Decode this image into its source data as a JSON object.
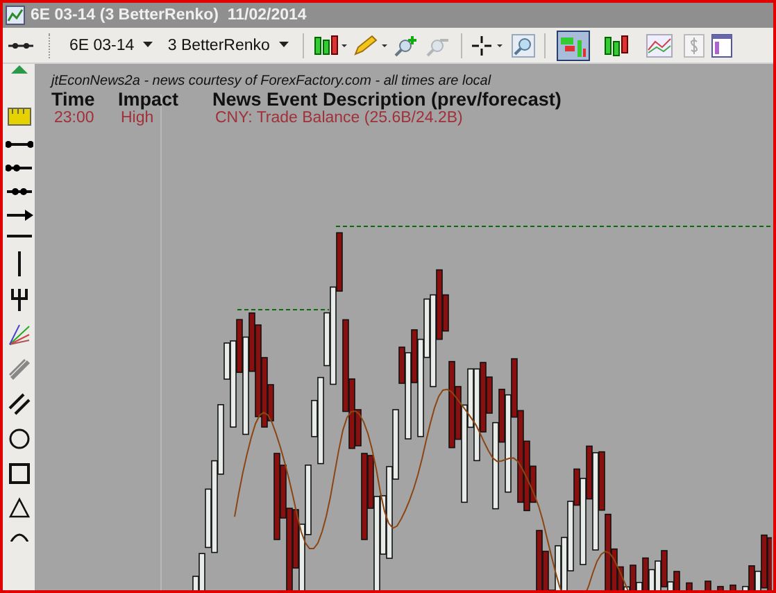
{
  "window": {
    "title": "6E 03-14 (3 BetterRenko)  11/02/2014"
  },
  "toolbar": {
    "instrument": "6E 03-14",
    "bar_type": "3 BetterRenko",
    "chart_style_buttons": [
      {
        "kind": "renko",
        "selected": true
      },
      {
        "kind": "candles",
        "selected": false
      },
      {
        "kind": "line",
        "selected": false
      }
    ]
  },
  "news": {
    "caption": "jtEconNews2a - news courtesy of ForexFactory.com - all times are local",
    "columns": [
      "Time",
      "Impact",
      "News Event Description (prev/forecast)"
    ],
    "rows": [
      {
        "time": "23:00",
        "impact": "High",
        "description": "CNY: Trade Balance (25.6B/24.2B)"
      }
    ]
  }
}
